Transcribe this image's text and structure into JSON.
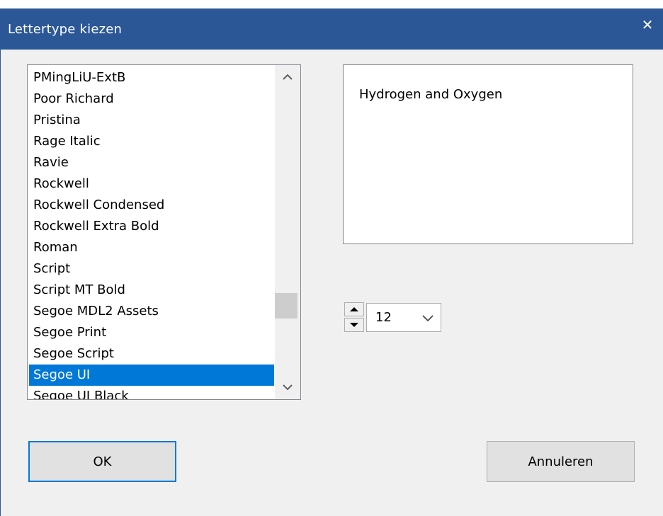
{
  "window": {
    "title": "Lettertype kiezen",
    "close_label": "✕"
  },
  "font_list": {
    "items": [
      "PMingLiU-ExtB",
      "Poor Richard",
      "Pristina",
      "Rage Italic",
      "Ravie",
      "Rockwell",
      "Rockwell Condensed",
      "Rockwell Extra Bold",
      "Roman",
      "Script",
      "Script MT Bold",
      "Segoe MDL2 Assets",
      "Segoe Print",
      "Segoe Script",
      "Segoe UI",
      "Segoe UI Black"
    ],
    "selected": "Segoe UI"
  },
  "preview": {
    "text": "Hydrogen and Oxygen"
  },
  "size": {
    "value": "12"
  },
  "buttons": {
    "ok_label": "OK",
    "cancel_label": "Annuleren"
  },
  "icons": {
    "close": "close-icon",
    "scroll_up": "chevron-up-icon",
    "scroll_down": "chevron-down-icon",
    "spin_up": "triangle-up-icon",
    "spin_down": "triangle-down-icon",
    "dropdown": "chevron-down-icon"
  },
  "colors": {
    "titlebar": "#2b5797",
    "selection": "#0078d7",
    "dialog_bg": "#f0f0f0"
  }
}
